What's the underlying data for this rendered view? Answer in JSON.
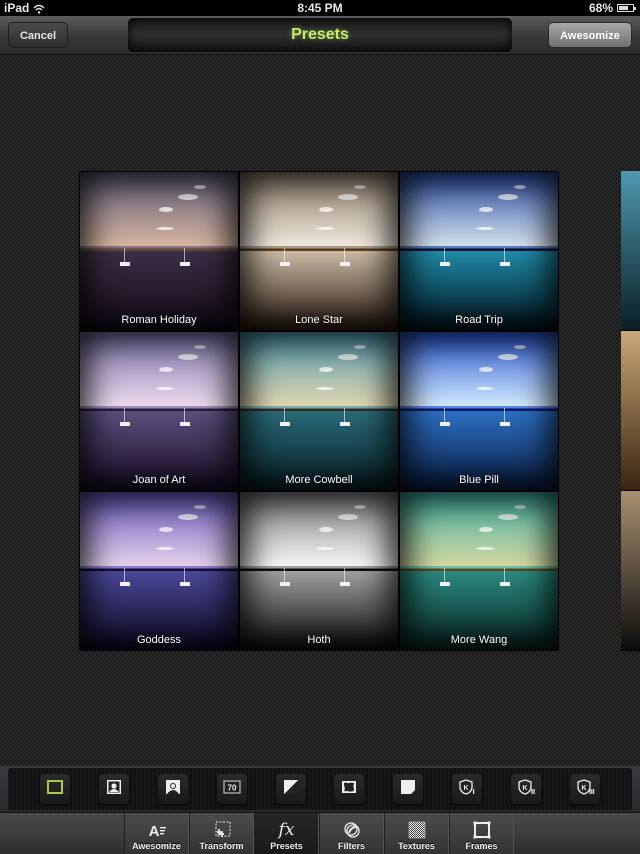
{
  "status_bar": {
    "device": "iPad",
    "time": "8:45 PM",
    "battery_percent": "68%",
    "battery_level": 0.68
  },
  "nav_bar": {
    "cancel_label": "Cancel",
    "title": "Presets",
    "awesomize_label": "Awesomize",
    "title_color": "#c4ec6a"
  },
  "presets": [
    {
      "label": "Roman Holiday",
      "sky": [
        "#5e5a7a",
        "#d9b7a0"
      ],
      "water": [
        "#3a2f45",
        "#140a18"
      ],
      "edge": "#6b4a2a"
    },
    {
      "label": "Lone Star",
      "sky": [
        "#8a7866",
        "#f1ebe0"
      ],
      "water": [
        "#c9b9a4",
        "#2a1a10"
      ],
      "edge": "#5a3c1e"
    },
    {
      "label": "Road Trip",
      "sky": [
        "#2b4fa8",
        "#d7e4ec"
      ],
      "water": [
        "#1f8aa8",
        "#02141e"
      ],
      "edge": "#081428"
    },
    {
      "label": "Joan of Art",
      "sky": [
        "#7a72a8",
        "#f0dcef"
      ],
      "water": [
        "#5a4f7c",
        "#1a0d26"
      ],
      "edge": "#2a1c38"
    },
    {
      "label": "More Cowbell",
      "sky": [
        "#4f98b0",
        "#e3d9b0"
      ],
      "water": [
        "#2a6978",
        "#071e24"
      ],
      "edge": "#3a2a14"
    },
    {
      "label": "Blue Pill",
      "sky": [
        "#2b5ad8",
        "#d4ecfa"
      ],
      "water": [
        "#2c6fc2",
        "#0a1c40"
      ],
      "edge": "#0a1a60"
    },
    {
      "label": "Goddess",
      "sky": [
        "#6a58c0",
        "#e8d4ec"
      ],
      "water": [
        "#4a4898",
        "#0c0820"
      ],
      "edge": "#14102a"
    },
    {
      "label": "Hoth",
      "sky": [
        "#7a7a7a",
        "#fafafa"
      ],
      "water": [
        "#a0a0a0",
        "#0c0c0c"
      ],
      "edge": "#0a0a0a"
    },
    {
      "label": "More Wang",
      "sky": [
        "#3fb4a6",
        "#d8d8a0"
      ],
      "water": [
        "#2a8a80",
        "#082220"
      ],
      "edge": "#6a4010"
    }
  ],
  "tools": [
    {
      "name": "frame-none-icon",
      "selected": true
    },
    {
      "name": "portrait-icon"
    },
    {
      "name": "portrait-corners-icon"
    },
    {
      "name": "number-70-icon",
      "text": "70"
    },
    {
      "name": "diagonal-split-icon"
    },
    {
      "name": "rough-edge-frame-icon"
    },
    {
      "name": "paper-corner-icon"
    },
    {
      "name": "k-badge-1-icon"
    },
    {
      "name": "k-badge-2-icon"
    },
    {
      "name": "k-badge-3-icon"
    }
  ],
  "tabs": [
    {
      "label": "Awesomize",
      "icon": "awesomize-icon"
    },
    {
      "label": "Transform",
      "icon": "crop-icon"
    },
    {
      "label": "Presets",
      "icon": "fx-icon",
      "active": true
    },
    {
      "label": "Filters",
      "icon": "filters-icon"
    },
    {
      "label": "Textures",
      "icon": "textures-icon"
    },
    {
      "label": "Frames",
      "icon": "frames-icon"
    }
  ],
  "tabs_icon_text": {
    "presets": "fx",
    "tool_70": "70"
  }
}
